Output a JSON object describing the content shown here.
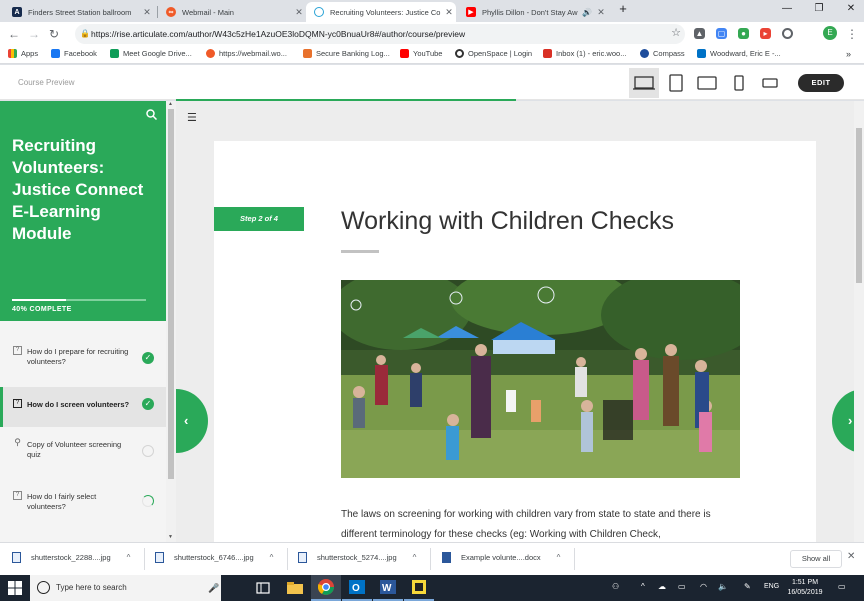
{
  "browser": {
    "tabs": [
      {
        "title": "Finders Street Station ballroom",
        "icon": "atlassian-icon",
        "color": "#172b4d",
        "active": false
      },
      {
        "title": "Webmail - Main",
        "icon": "webmail-icon",
        "color": "#f05a28",
        "active": false
      },
      {
        "title": "Recruiting Volunteers: Justice Co",
        "icon": "rise-icon",
        "color": "#2aa3d6",
        "active": true
      },
      {
        "title": "Phyllis Dillon - Don't Stay Aw",
        "icon": "youtube-icon",
        "color": "#ff0000",
        "active": false
      }
    ],
    "new_tab_symbol": "+",
    "url": "https://rise.articulate.com/author/W43c5zHe1AzuOE3loDQMN-yc0BnuaUr8#/author/course/preview",
    "profile_initial": "E",
    "bookmarks": [
      {
        "label": "Apps",
        "color": "#5f6368"
      },
      {
        "label": "Facebook",
        "color": "#1877f2"
      },
      {
        "label": "Meet Google Drive...",
        "color": "#0f9d58"
      },
      {
        "label": "https://webmail.wo...",
        "color": "#f05a28"
      },
      {
        "label": "Secure Banking Log...",
        "color": "#e8712c"
      },
      {
        "label": "YouTube",
        "color": "#ff0000"
      },
      {
        "label": "OpenSpace | Login",
        "color": "#333333"
      },
      {
        "label": "Inbox (1) - eric.woo...",
        "color": "#d93025"
      },
      {
        "label": "Compass",
        "color": "#1f4e9c"
      },
      {
        "label": "Woodward, Eric E -...",
        "color": "#0072c6"
      }
    ],
    "bookmarks_more": "»"
  },
  "rise": {
    "course_preview_label": "Course Preview",
    "edit_label": "EDIT",
    "course_title": "Recruiting Volunteers: Justice Connect E-Learning Module",
    "progress_label": "40% COMPLETE",
    "progress_fraction": 0.4,
    "accent_color": "#2aa959",
    "lessons": [
      {
        "title": "How do I prepare for recruiting volunteers?",
        "status": "complete"
      },
      {
        "title": "How do I screen volunteers?",
        "status": "complete"
      },
      {
        "title": "Copy of Volunteer screening quiz",
        "status": "not-started"
      },
      {
        "title": "How do I fairly select volunteers?",
        "status": "in-progress"
      }
    ],
    "step_label": "Step 2 of 4",
    "lesson_title": "Working with Children Checks",
    "body_text": "The laws on screening for working with children vary from state to state and there is different terminology for these checks (eg: Working with Children Check,",
    "prev_symbol": "‹",
    "next_symbol": "›"
  },
  "downloads": {
    "items": [
      {
        "name": "shutterstock_2288....jpg"
      },
      {
        "name": "shutterstock_6746....jpg"
      },
      {
        "name": "shutterstock_5274....jpg"
      },
      {
        "name": "Example volunte....docx"
      }
    ],
    "show_all": "Show all"
  },
  "taskbar": {
    "search_placeholder": "Type here to search",
    "language": "ENG",
    "time": "1:51 PM",
    "date": "16/05/2019"
  }
}
